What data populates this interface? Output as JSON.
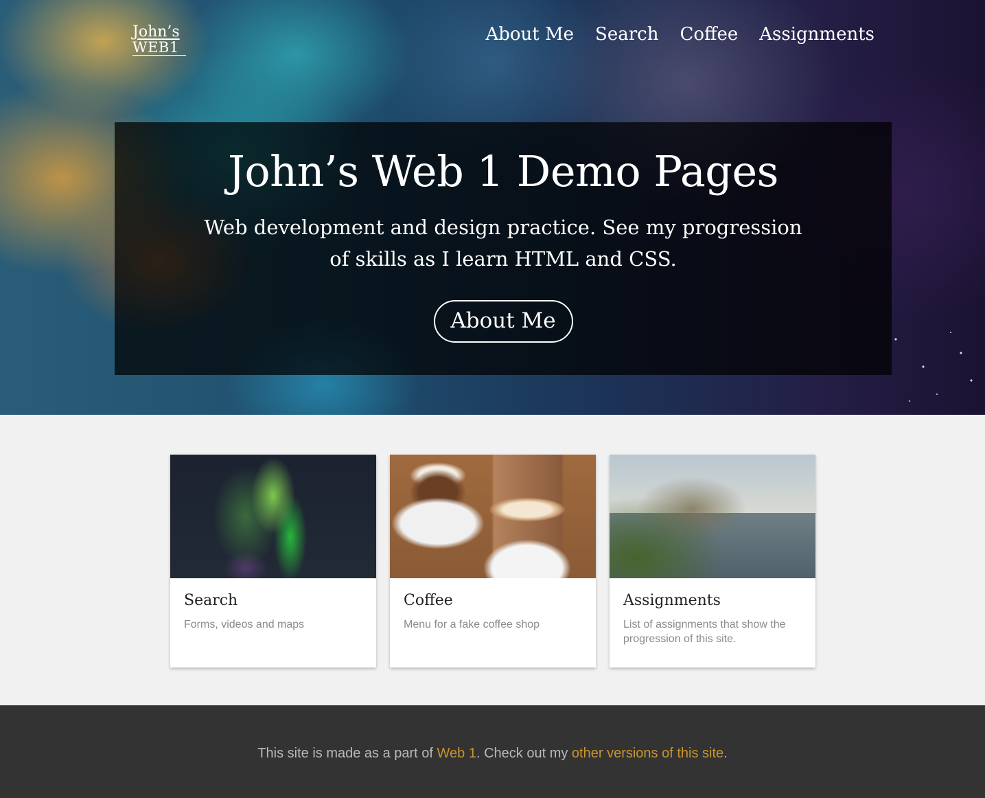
{
  "logo": {
    "line1": "John’s",
    "line2": "WEB1"
  },
  "nav": {
    "items": [
      {
        "label": "About Me"
      },
      {
        "label": "Search"
      },
      {
        "label": "Coffee"
      },
      {
        "label": "Assignments"
      }
    ]
  },
  "hero": {
    "title": "John’s Web 1 Demo Pages",
    "subtitle": "Web development and design practice. See my progression of skills as I learn HTML and CSS.",
    "button_label": "About Me"
  },
  "cards": [
    {
      "title": "Search",
      "description": "Forms, videos and maps",
      "image": "aurora-photo"
    },
    {
      "title": "Coffee",
      "description": "Menu for a fake coffee shop",
      "image": "coffee-photo"
    },
    {
      "title": "Assignments",
      "description": "List of assignments that show the progression of this site.",
      "image": "coast-photo"
    }
  ],
  "footer": {
    "text1": "This site is made as a part of ",
    "link1": "Web 1",
    "text2": ". Check out my ",
    "link2": "other versions of this site",
    "text3": "."
  },
  "colors": {
    "footer_bg": "#333333",
    "footer_link": "#c9952c",
    "page_bg": "#f1f1f1"
  }
}
